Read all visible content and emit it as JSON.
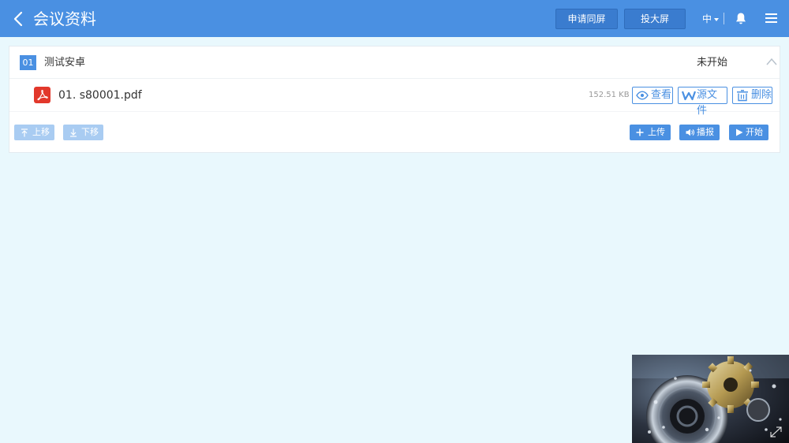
{
  "header": {
    "title": "会议资料",
    "share_label": "申请同屏",
    "cast_label": "投大屏",
    "language": "中"
  },
  "agenda": {
    "number": "01",
    "title": "测试安卓",
    "status": "未开始",
    "files": [
      {
        "name": "01. s80001.pdf",
        "size": "152.51 KB",
        "view_label": "查看",
        "source_label": "源文件",
        "delete_label": "删除"
      }
    ],
    "move_up_label": "上移",
    "move_down_label": "下移",
    "upload_label": "上传",
    "broadcast_label": "播报",
    "start_label": "开始"
  },
  "icons": {
    "back": "chevron-left-icon",
    "bell": "bell-icon",
    "menu": "hamburger-menu-icon",
    "collapse": "chevron-up-icon",
    "file": "pdf-icon",
    "view": "eye-icon",
    "source": "wps-icon",
    "delete": "trash-icon",
    "up": "arrow-up-icon",
    "down": "arrow-down-icon",
    "upload": "plus-icon",
    "broadcast": "speaker-icon",
    "start": "play-icon",
    "expand": "expand-icon"
  },
  "colors": {
    "primary": "#4a90e2",
    "header_button": "#3a7ccf",
    "background": "#e9f8fd",
    "disabled_button": "#a9ccf2",
    "pdf_red": "#e2382b"
  }
}
